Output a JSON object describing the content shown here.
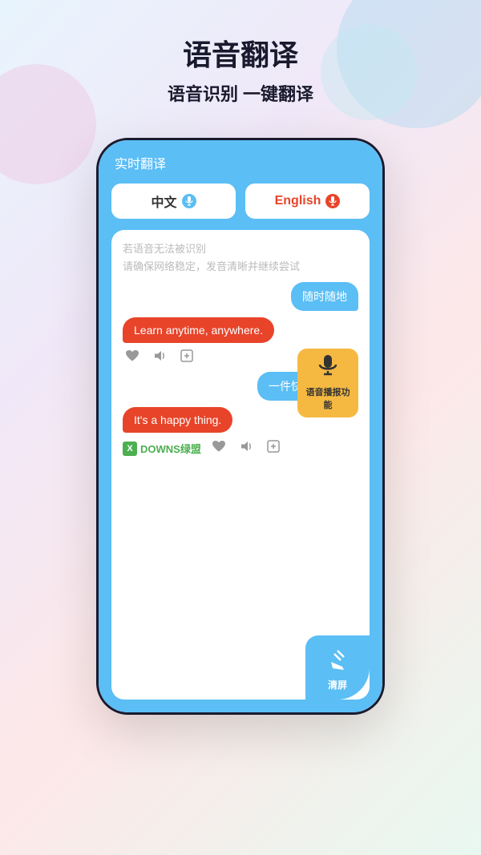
{
  "header": {
    "title": "语音翻译",
    "subtitle": "语音识别 一键翻译"
  },
  "phone": {
    "app_title": "实时翻译",
    "lang_chinese": "中文",
    "lang_english": "English",
    "hint_line1": "若语音无法被识别",
    "hint_line2": "请确保网络稳定，发音清晰并继续尝试",
    "messages": [
      {
        "type": "right",
        "text": "随时随地",
        "color": "#5bbef5"
      },
      {
        "type": "left",
        "text": "Learn anytime, anywhere.",
        "color": "#e8442a"
      },
      {
        "type": "right",
        "text": "一件快乐的事。",
        "color": "#5bbef5"
      },
      {
        "type": "left",
        "text": "It's a happy thing.",
        "color": "#e8442a"
      }
    ],
    "tooltip_text": "语音播报功能",
    "watermark": "DOWNS绿盟",
    "clear_label": "清屏"
  },
  "icons": {
    "mic_symbol": "🎤",
    "heart": "♥",
    "speaker": "🔊",
    "share": "⊕",
    "broom": "🧹"
  }
}
